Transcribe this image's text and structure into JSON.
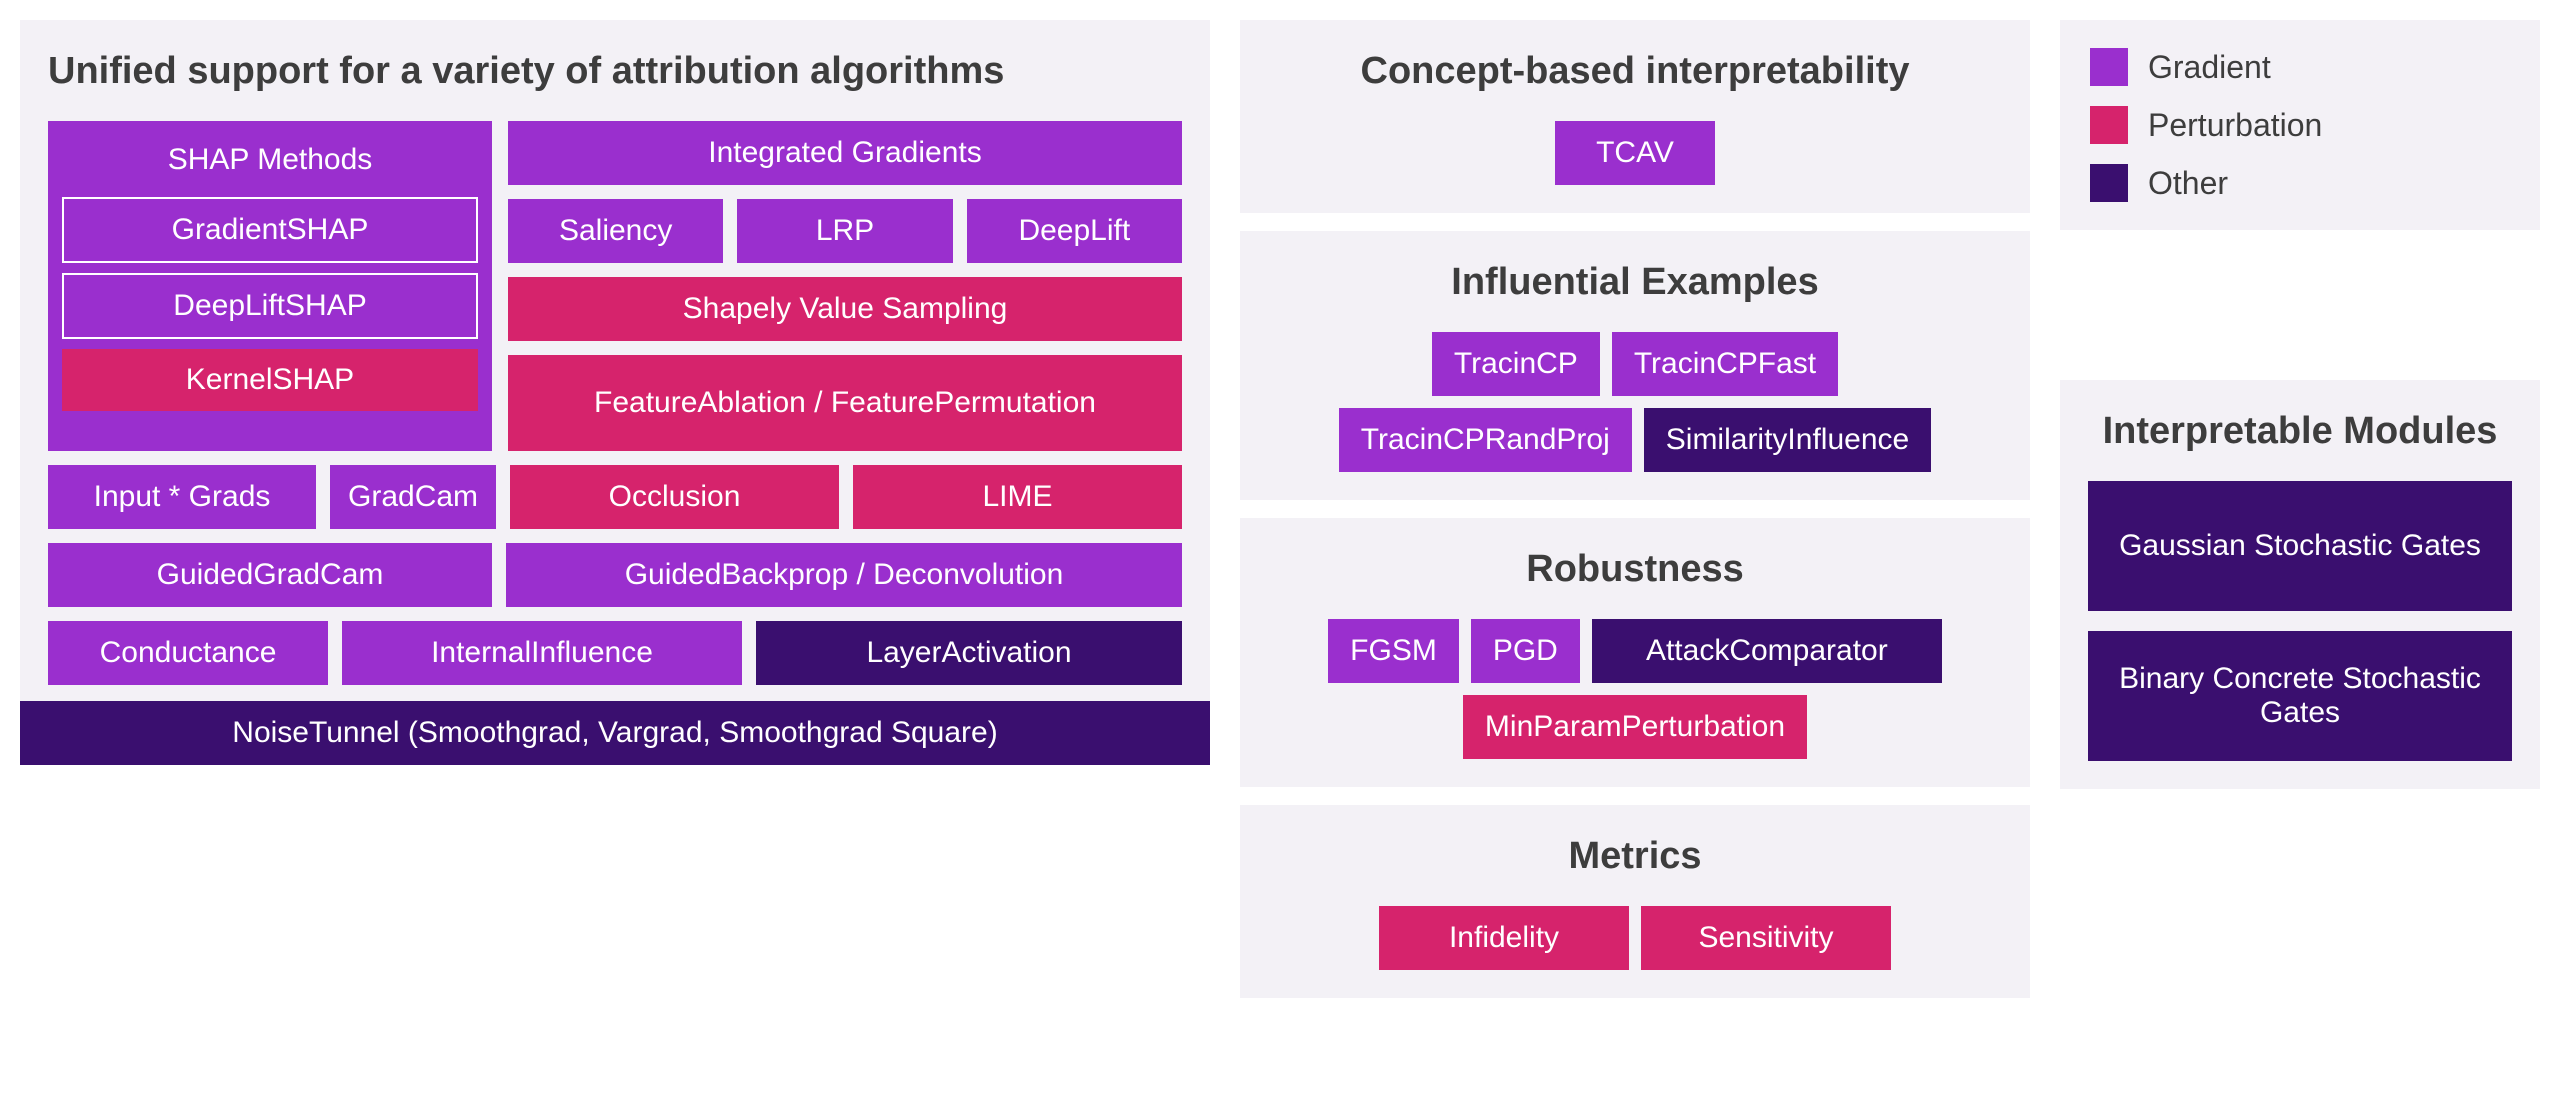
{
  "colors": {
    "gradient": "#9a2fce",
    "perturbation": "#d6236c",
    "other": "#3a0f6f",
    "panel_bg": "#f3f1f6",
    "text_dark": "#3d3d3d"
  },
  "legend": {
    "gradient": "Gradient",
    "perturbation": "Perturbation",
    "other": "Other"
  },
  "attribution": {
    "title": "Unified support for a variety of attribution algorithms",
    "shap": {
      "header": "SHAP Methods",
      "gradient_shap": "GradientSHAP",
      "deeplift_shap": "DeepLiftSHAP",
      "kernel_shap": "KernelSHAP"
    },
    "integrated_gradients": "Integrated Gradients",
    "saliency": "Saliency",
    "lrp": "LRP",
    "deeplift": "DeepLift",
    "shapely_sampling": "Shapely Value Sampling",
    "feature_ablation": "FeatureAblation / FeaturePermutation",
    "occlusion": "Occlusion",
    "lime": "LIME",
    "input_grads": "Input * Grads",
    "gradcam": "GradCam",
    "guided_gradcam": "GuidedGradCam",
    "guided_backprop": "GuidedBackprop / Deconvolution",
    "conductance": "Conductance",
    "internal_influence": "InternalInfluence",
    "layer_activation": "LayerActivation",
    "noise_tunnel": "NoiseTunnel (Smoothgrad, Vargrad, Smoothgrad Square)"
  },
  "concept": {
    "title": "Concept-based interpretability",
    "tcav": "TCAV"
  },
  "influential": {
    "title": "Influential Examples",
    "tracincp": "TracinCP",
    "tracincp_fast": "TracinCPFast",
    "tracincp_randproj": "TracinCPRandProj",
    "similarity_influence": "SimilarityInfluence"
  },
  "robustness": {
    "title": "Robustness",
    "fgsm": "FGSM",
    "pgd": "PGD",
    "attack_comparator": "AttackComparator",
    "min_param_perturbation": "MinParamPerturbation"
  },
  "metrics": {
    "title": "Metrics",
    "infidelity": "Infidelity",
    "sensitivity": "Sensitivity"
  },
  "modules": {
    "title": "Interpretable Modules",
    "gaussian": "Gaussian Stochastic Gates",
    "binary": "Binary Concrete Stochastic Gates"
  }
}
